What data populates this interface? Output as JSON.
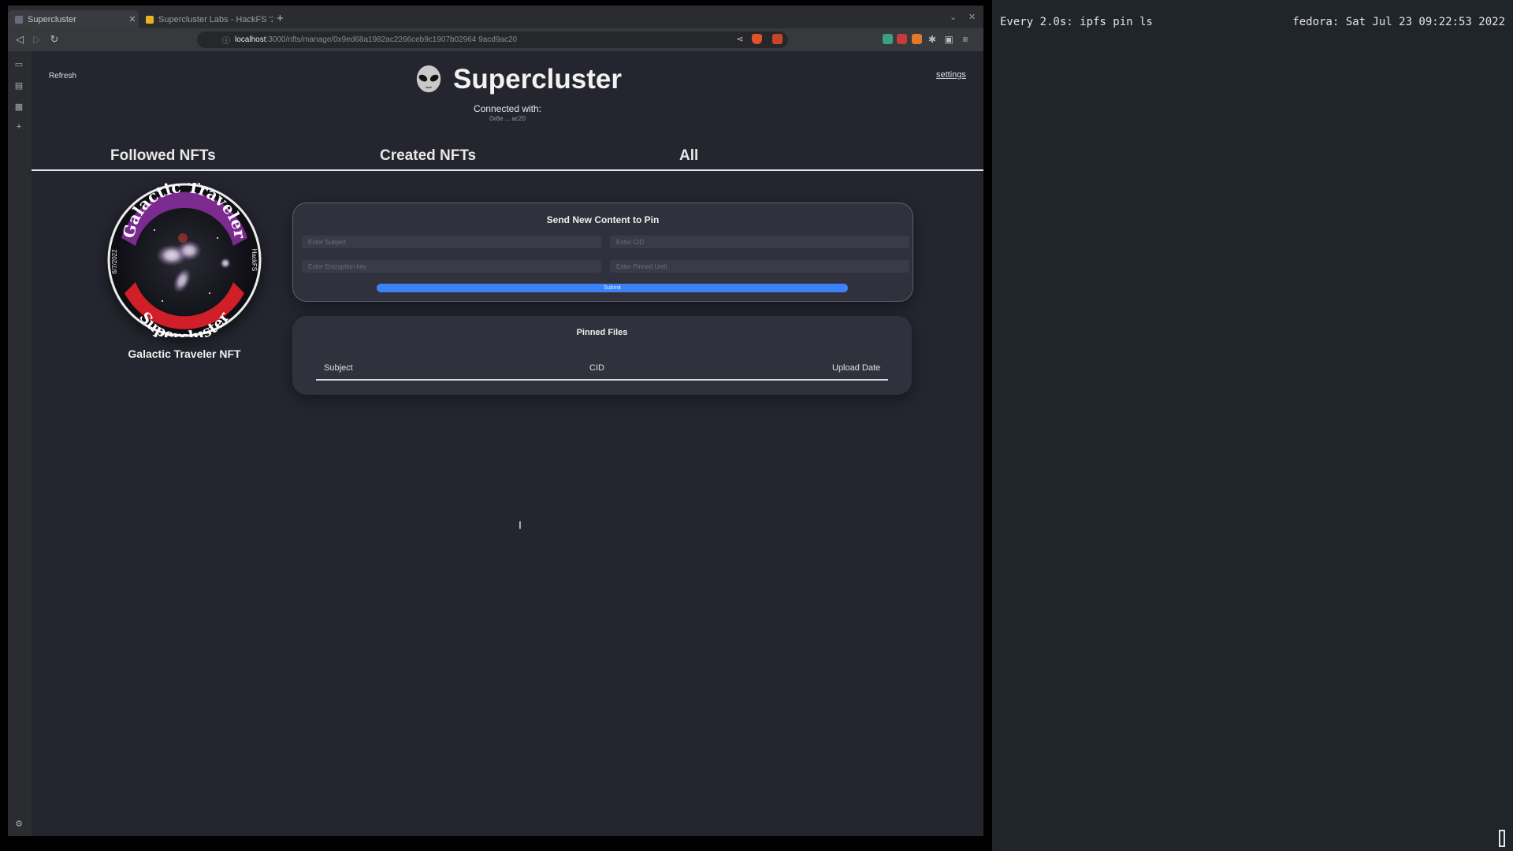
{
  "browser": {
    "tabs": [
      {
        "title": "Supercluster",
        "active": true
      },
      {
        "title": "Supercluster Labs - HackFS '2",
        "active": false
      }
    ],
    "url_host": "localhost",
    "url_path": ":3000/nfts/manage/0x9ed68a1982ac2266ceb9c1907b02964 9acd9ac20"
  },
  "page": {
    "refresh_label": "Refresh",
    "settings_label": "settings",
    "brand_title": "Supercluster",
    "connected_label": "Connected with:",
    "connected_address": "0x6e ... ac20",
    "tabs": [
      {
        "label": "Followed NFTs"
      },
      {
        "label": "Created NFTs"
      },
      {
        "label": "All"
      }
    ],
    "nft": {
      "name": "Galactic Traveler NFT",
      "badge_top_text": "Galactic Traveler",
      "badge_bottom_text": "Supercluster",
      "badge_left_text": "6/7/2022",
      "badge_right_text": "HackFS"
    },
    "send_form": {
      "title": "Send New Content to Pin",
      "subject_placeholder": "Enter Subject",
      "cid_placeholder": "Enter CID",
      "encryption_placeholder": "Enter Encryption key",
      "pinned_until_placeholder": "Enter Pinned Until",
      "submit_label": "Submit"
    },
    "pinned_files": {
      "title": "Pinned Files",
      "columns": [
        "Subject",
        "CID",
        "Upload Date"
      ],
      "rows": []
    }
  },
  "terminal": {
    "left_text": "Every 2.0s: ipfs pin ls",
    "right_text": "fedora: Sat Jul 23 09:22:53 2022"
  },
  "colors": {
    "page_bg": "#24252f",
    "card_bg": "#30313c",
    "submit_blue": "#3b82f6",
    "badge_purple": "#7b2a8f",
    "badge_red": "#d11f2a",
    "terminal_bg": "#20242b"
  }
}
